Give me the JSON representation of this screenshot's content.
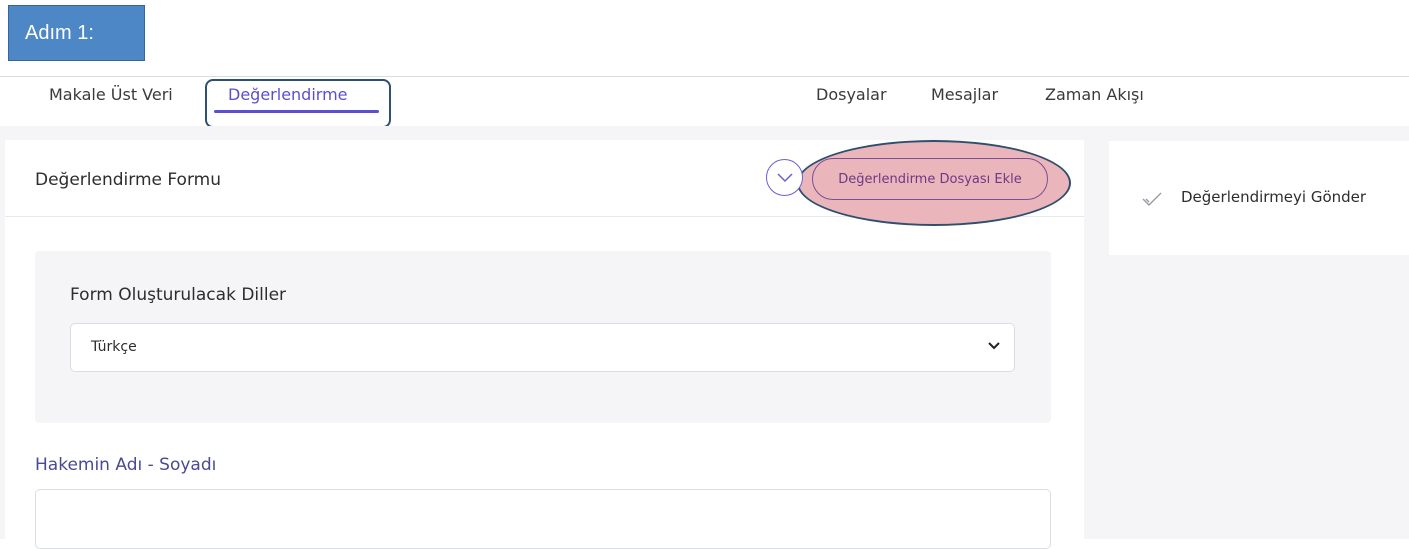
{
  "step": {
    "label": "Adım 1:"
  },
  "tabs": {
    "metadata": "Makale Üst Veri",
    "review": "Değerlendirme",
    "files": "Dosyalar",
    "messages": "Mesajlar",
    "timeline": "Zaman Akışı",
    "active": "review"
  },
  "form": {
    "title": "Değerlendirme Formu",
    "collapse_icon": "chevron-down-icon",
    "add_file_label": "Değerlendirme Dosyası Ekle",
    "languages": {
      "label": "Form Oluşturulacak Diller",
      "selected": "Türkçe"
    },
    "referee": {
      "label": "Hakemin Adı - Soyadı",
      "value": ""
    }
  },
  "sidebar": {
    "submit_label": "Değerlendirmeyi Gönder",
    "submit_icon": "check-icon"
  },
  "colors": {
    "accent": "#5a4fd0",
    "step_badge": "#4d87c6",
    "highlight_fill": "#eab6bb",
    "annotation_outline": "#2f4f70"
  }
}
